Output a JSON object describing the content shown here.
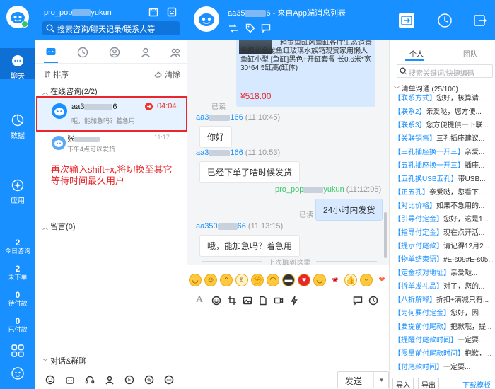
{
  "rail": {
    "chat_label": "聊天",
    "data_label": "数据",
    "apps_label": "应用",
    "stats": [
      {
        "num": "2",
        "label": "今日咨询"
      },
      {
        "num": "2",
        "label": "未下单"
      },
      {
        "num": "0",
        "label": "待付款"
      },
      {
        "num": "0",
        "label": "已付款"
      }
    ]
  },
  "header": {
    "account_prefix": "pro_pop",
    "account_suffix": "yukun",
    "search_placeholder": "搜索咨询/聊天记录/联系人等"
  },
  "list": {
    "sort_label": "排序",
    "clear_label": "清除",
    "online_group": "在线咨询(2/2)",
    "items": [
      {
        "name_prefix": "aa3",
        "name_suffix": "6",
        "preview": "哦，能加急吗？着急用",
        "time": "04:04"
      },
      {
        "name_prefix": "张",
        "name_suffix": "",
        "preview": "下午4点可以发货",
        "time": "11:17"
      }
    ],
    "annotation": "再次输入shift+x,将切换至其它等待时间最久用户",
    "message_group": "留言(0)",
    "group_group": "对话&群聊"
  },
  "chat": {
    "title_prefix": "aa35",
    "title_suffix": "6 - 来自App端消息列表",
    "product": {
      "desc": "箱金鱼缸风鱼缸客厅生态造景免换水金龙鱼缸玻璃水族箱观赏家用懒人鱼缸小型 [鱼缸]黑色+开缸套餐 长0.6米*宽30*64.5缸高(缸体)",
      "price": "¥518.00"
    },
    "read_label": "已读",
    "messages": [
      {
        "name_prefix": "aa3",
        "name_suffix": "166",
        "time": "(11:10:45)",
        "text": "你好"
      },
      {
        "name_prefix": "aa3",
        "name_suffix": "166",
        "time": "(11:10:53)",
        "text": "已经下单了啥时候发货"
      },
      {
        "name_prefix": "pro_pop",
        "name_suffix": "yukun",
        "time": "(11:12:05)",
        "text": "24小时内发货"
      },
      {
        "name_prefix": "aa350",
        "name_suffix": "66",
        "time": "(11:13:15)",
        "text": "哦，能加急吗？着急用"
      }
    ],
    "last_read": "上次聊到这里",
    "send_label": "发送"
  },
  "right": {
    "tab_personal": "个人",
    "tab_team": "团队",
    "search_placeholder": "搜索关键词/快捷编码",
    "category": "清单沟通 (25/100)",
    "items": [
      {
        "tag": "【联系方式】",
        "text": "您好，核算请..."
      },
      {
        "tag": "【联系2】",
        "text": "亲爱哒，您方便..."
      },
      {
        "tag": "【联系3】",
        "text": "您方便提供一下联..."
      },
      {
        "tag": "【关联销售】",
        "text": "三孔插座建议..."
      },
      {
        "tag": "【三孔插座换一开三】",
        "text": "亲爱..."
      },
      {
        "tag": "【五孔插座换一开三】",
        "text": "插座..."
      },
      {
        "tag": "【五孔换USB五孔】",
        "text": "带USB..."
      },
      {
        "tag": "【正五孔】",
        "text": "亲爱哒，您看下..."
      },
      {
        "tag": "【对比价格】",
        "text": "如果不急用的..."
      },
      {
        "tag": "【引导付定金】",
        "text": "您好，这是1..."
      },
      {
        "tag": "【指导付定金】",
        "text": "现在点开活..."
      },
      {
        "tag": "【提示付尾款】",
        "text": "请记得12月2..."
      },
      {
        "tag": "【物单结束语】",
        "text": "#E-s09#E-s05..."
      },
      {
        "tag": "【定金核对地址】",
        "text": "亲爱哒..."
      },
      {
        "tag": "【拆单发礼品】",
        "text": "对了，您的..."
      },
      {
        "tag": "【八折解释】",
        "text": "折扣+满减只有..."
      },
      {
        "tag": "【为何要付定金】",
        "text": "您好，因..."
      },
      {
        "tag": "【要提前付尾款】",
        "text": "抱歉哦，提..."
      },
      {
        "tag": "【提醒付尾款时间】",
        "text": "一定要..."
      },
      {
        "tag": "【限量前付尾款时间】",
        "text": "抱歉，..."
      },
      {
        "tag": "【付尾款时间】",
        "text": "一定要..."
      }
    ],
    "import_label": "导入",
    "export_label": "导出",
    "download_label": "下载模板"
  }
}
